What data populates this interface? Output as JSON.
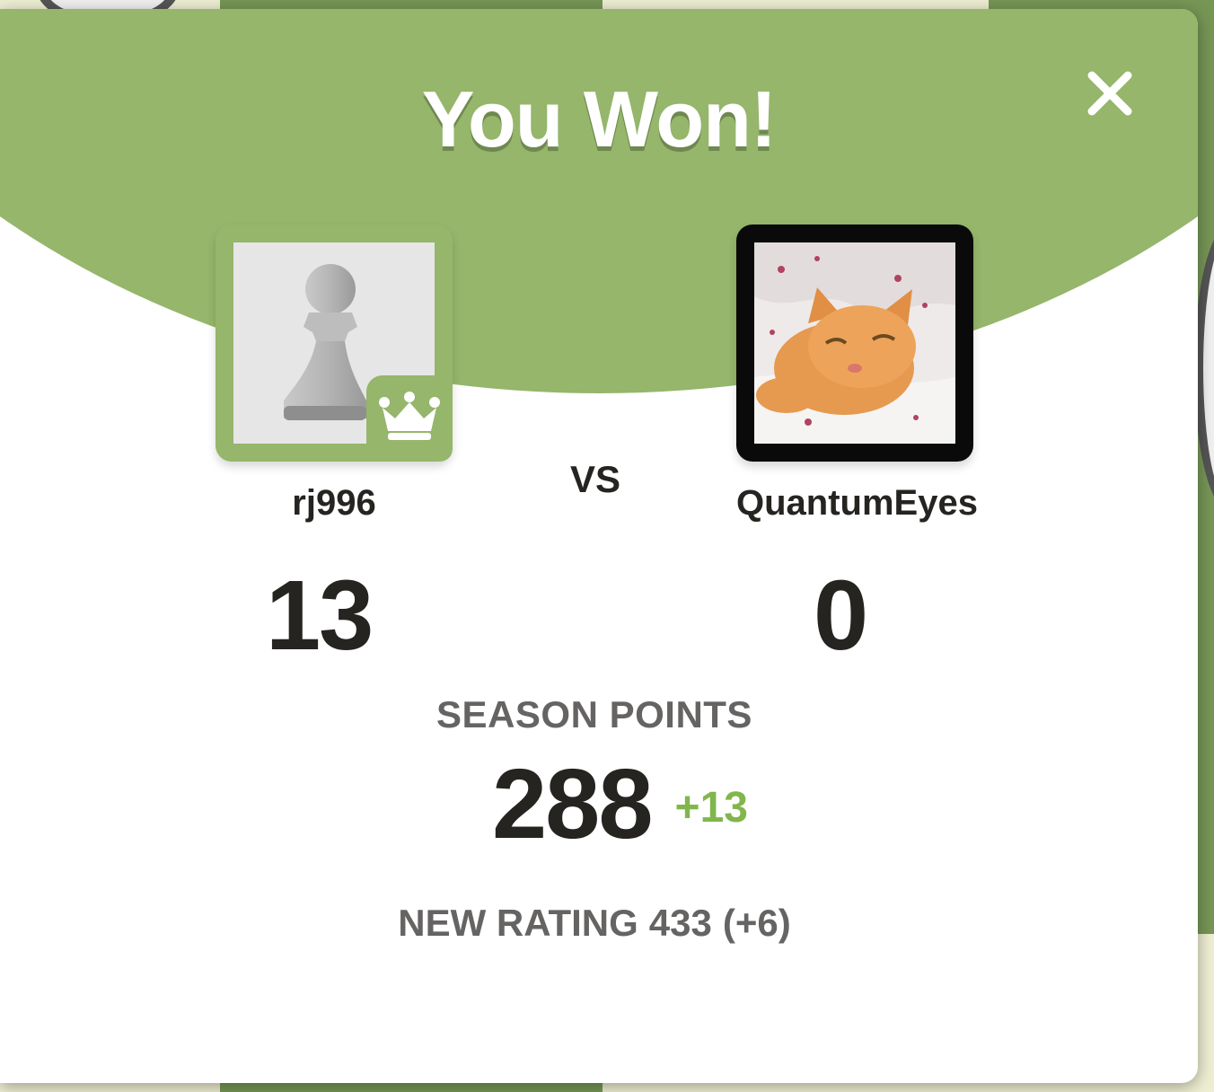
{
  "modal": {
    "title": "You Won!",
    "close_icon": "close-icon",
    "vs_label": "VS"
  },
  "players": [
    {
      "username": "rj996",
      "score": "13",
      "avatar": "pawn-icon",
      "badge": "crown-icon",
      "winner": true
    },
    {
      "username": "QuantumEyes",
      "score": "0",
      "avatar": "cat-photo",
      "winner": false
    }
  ],
  "season": {
    "label": "SEASON POINTS",
    "value": "288",
    "delta": "+13"
  },
  "rating": {
    "label": "NEW RATING",
    "value": "433",
    "change": "(+6)"
  },
  "colors": {
    "brand_green": "#95b66b",
    "delta_green": "#81b64c",
    "text_dark": "#262421",
    "text_muted": "#666463"
  }
}
